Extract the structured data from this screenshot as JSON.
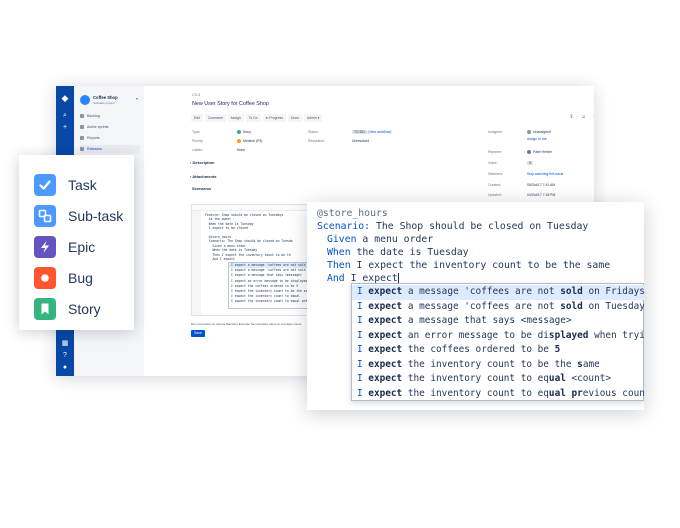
{
  "jira": {
    "project": {
      "name": "Coffee Shop",
      "type": "Software project"
    },
    "sidebar": [
      {
        "label": "Backlog",
        "active": false
      },
      {
        "label": "Active sprints",
        "active": false
      },
      {
        "label": "Reports",
        "active": false
      },
      {
        "label": "Releases",
        "active": true
      }
    ],
    "breadcrumb": "CS-5",
    "issue_title": "New User Story for Coffee Shop",
    "toolbar": [
      "Edit",
      "Comment",
      "Assign",
      "To Do",
      "In Progress",
      "Done",
      "Admin ▾"
    ],
    "fields": {
      "type_label": "Type:",
      "type_value": "Story",
      "priority_label": "Priority:",
      "priority_value": "Medium (P3)",
      "labels_label": "Labels:",
      "labels_value": "None",
      "status_label": "Status:",
      "status_value": "TO DO",
      "status_link": "(View workflow)",
      "resolution_label": "Resolution:",
      "resolution_value": "Unresolved",
      "assignee_label": "Assignee:",
      "assignee_value": "Unassigned",
      "assign_link": "Assign to me",
      "reporter_label": "Reporter:",
      "reporter_value": "Patel Herber",
      "votes_label": "Votes:",
      "votes_value": "0",
      "watchers_label": "Watchers:",
      "watchers_value": "Stop watching this issue",
      "created_label": "Created:",
      "created_value": "05/Oct/17 7:41 AM",
      "updated_label": "Updated:",
      "updated_value": "04/Oct/17 7:18 PM"
    },
    "sections": {
      "description": "Description",
      "attachments": "Attachments",
      "scenarios": "Scenarios"
    },
    "mini_code": [
      "Feature: Shop should be closed on Tuesdays",
      "  As the owner",
      "  When the date is Tuesday",
      "  I expect to be closed",
      "",
      "  @store_hours",
      "  Scenario: The Shop should be closed on Tuesda",
      "    Given a menu order",
      "    When the date is Tuesday",
      "    Then I expect the inventory count to be th",
      "    And I expect"
    ],
    "mini_checkbox": "Run scenarios on remote Bamboo   Execute   Set scenario name to a unique name",
    "save_label": "Save"
  },
  "issue_types": [
    {
      "label": "Task",
      "icon": "checkmark-icon",
      "color": "#4c9aff"
    },
    {
      "label": "Sub-task",
      "icon": "subtask-icon",
      "color": "#4c9aff"
    },
    {
      "label": "Epic",
      "icon": "lightning-icon",
      "color": "#6554c0"
    },
    {
      "label": "Bug",
      "icon": "bug-dot-icon",
      "color": "#ff5630"
    },
    {
      "label": "Story",
      "icon": "bookmark-icon",
      "color": "#36b37e"
    }
  ],
  "editor": {
    "lines": {
      "tag": "@store_hours",
      "scenario_kw": "Scenario:",
      "scenario_text": " The Shop should be closed on Tuesday",
      "given_kw": "Given",
      "given_text": " a menu order",
      "when_kw": "When",
      "when_text": " the date is Tuesday",
      "then_kw": "Then",
      "then_text": " I expect the inventory count to be the same",
      "and_kw": "And",
      "and_text": " I expect"
    },
    "suggestions": [
      {
        "lead": "I ",
        "bold": "expect",
        "mid": " a message 'coffees are not ",
        "bold2": "sold",
        "tail": " on Fridays'",
        "selected": true
      },
      {
        "lead": "I ",
        "bold": "expect",
        "mid": " a message 'coffees are not ",
        "bold2": "sold",
        "tail": " on Tuesdays'",
        "selected": false
      },
      {
        "lead": "I ",
        "bold": "expect",
        "mid": " a message that says <message>",
        "bold2": "",
        "tail": "",
        "selected": false
      },
      {
        "lead": "I ",
        "bold": "expect",
        "mid": " an error message to be di",
        "bold2": "splayed",
        "tail": " when trying to order",
        "selected": false
      },
      {
        "lead": "I ",
        "bold": "expect",
        "mid": " the coffees ordered to be ",
        "bold2": "5",
        "tail": "",
        "selected": false
      },
      {
        "lead": "I ",
        "bold": "expect",
        "mid": " the inventory count to be the ",
        "bold2": "s",
        "tail": "ame",
        "selected": false
      },
      {
        "lead": "I ",
        "bold": "expect",
        "mid": " the inventory count to eq",
        "bold2": "ual",
        "tail": " <count>",
        "selected": false
      },
      {
        "lead": "I ",
        "bold": "expect",
        "mid": " the inventory count to eq",
        "bold2": "ual pr",
        "tail": "evious count",
        "selected": false
      }
    ]
  }
}
